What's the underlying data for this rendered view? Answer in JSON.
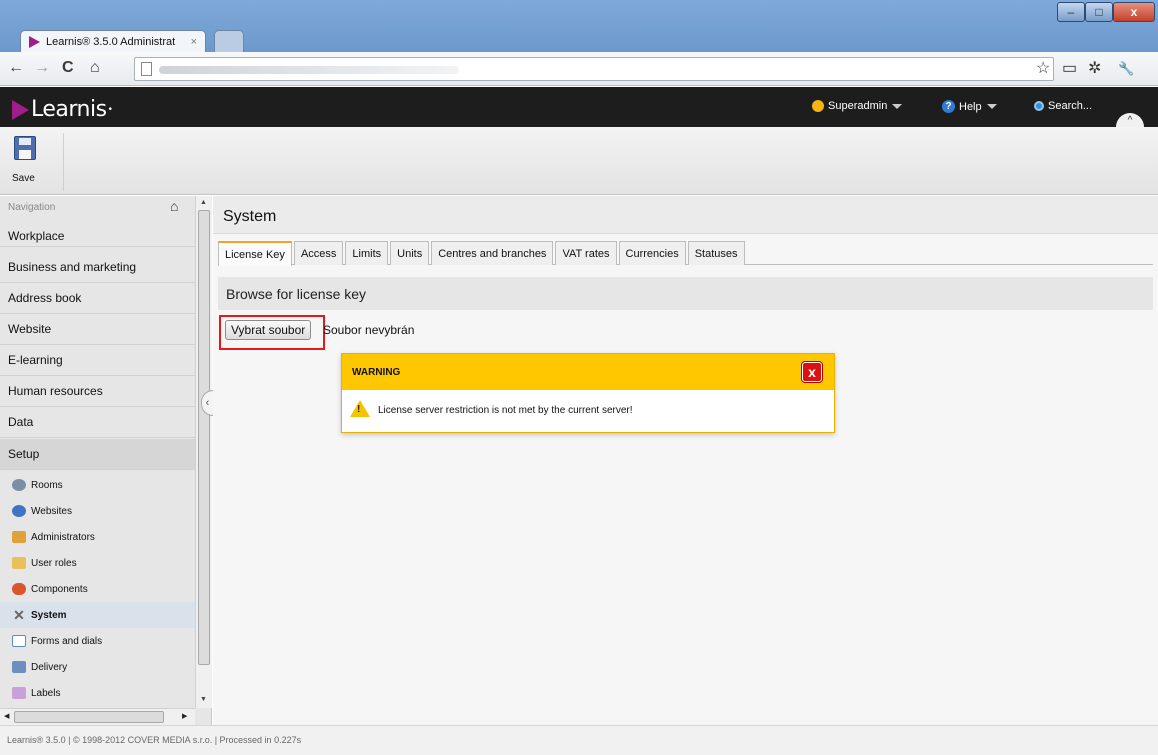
{
  "browser": {
    "tab_title": "Learnis® 3.5.0 Administrat",
    "tab_close": "×",
    "url": "",
    "window_buttons": {
      "minimize": "–",
      "maximize": "□",
      "close": "x"
    },
    "nav": {
      "back": "←",
      "forward": "→",
      "reload": "C",
      "home": "⌂"
    },
    "toolbar_icons": {
      "star": "☆",
      "page": "▭",
      "settings": "✲",
      "wrench": "🔧"
    }
  },
  "header": {
    "logo_text": "Learnis",
    "logo_mark": "•",
    "user": "Superadmin",
    "help": "Help",
    "help_icon_glyph": "?",
    "search": "Search..."
  },
  "actions": {
    "save_label": "Save"
  },
  "sidebar": {
    "heading": "Navigation",
    "items": [
      {
        "label": "Workplace"
      },
      {
        "label": "Business and marketing"
      },
      {
        "label": "Address book"
      },
      {
        "label": "Website"
      },
      {
        "label": "E-learning"
      },
      {
        "label": "Human resources"
      },
      {
        "label": "Data"
      },
      {
        "label": "Setup"
      }
    ],
    "subitems": [
      {
        "label": "Rooms",
        "icon": "rooms-icon",
        "color": "#7a8fa6"
      },
      {
        "label": "Websites",
        "icon": "globe-icon",
        "color": "#3f74c0"
      },
      {
        "label": "Administrators",
        "icon": "administrators-icon",
        "color": "#e0a03a"
      },
      {
        "label": "User roles",
        "icon": "user-roles-icon",
        "color": "#e9c15a"
      },
      {
        "label": "Components",
        "icon": "components-icon",
        "color": "#d9562f"
      },
      {
        "label": "System",
        "icon": "system-icon",
        "color": "#7a7a7a"
      },
      {
        "label": "Forms and dials",
        "icon": "forms-icon",
        "color": "#5a8bc9"
      },
      {
        "label": "Delivery",
        "icon": "delivery-icon",
        "color": "#6c8fbf"
      },
      {
        "label": "Labels",
        "icon": "labels-icon",
        "color": "#c9a0d8"
      }
    ]
  },
  "main": {
    "title": "System",
    "tabs": [
      "License Key",
      "Access",
      "Limits",
      "Units",
      "Centres and branches",
      "VAT rates",
      "Currencies",
      "Statuses"
    ],
    "active_tab": "License Key",
    "section_title": "Browse for license key",
    "file_button": "Vybrat soubor",
    "file_status": "Soubor nevybrán",
    "warning": {
      "title": "WARNING",
      "close": "x",
      "icon_glyph": "!",
      "message": "License server restriction is not met by the current server!"
    }
  },
  "footer": {
    "text": "Learnis® 3.5.0 | © 1998-2012 COVER MEDIA s.r.o. | Processed in 0.227s"
  },
  "colors": {
    "brand": "#a21d8c",
    "warning": "#ffc700",
    "highlight": "#e11b1b",
    "tab_accent": "#f0a22a"
  }
}
